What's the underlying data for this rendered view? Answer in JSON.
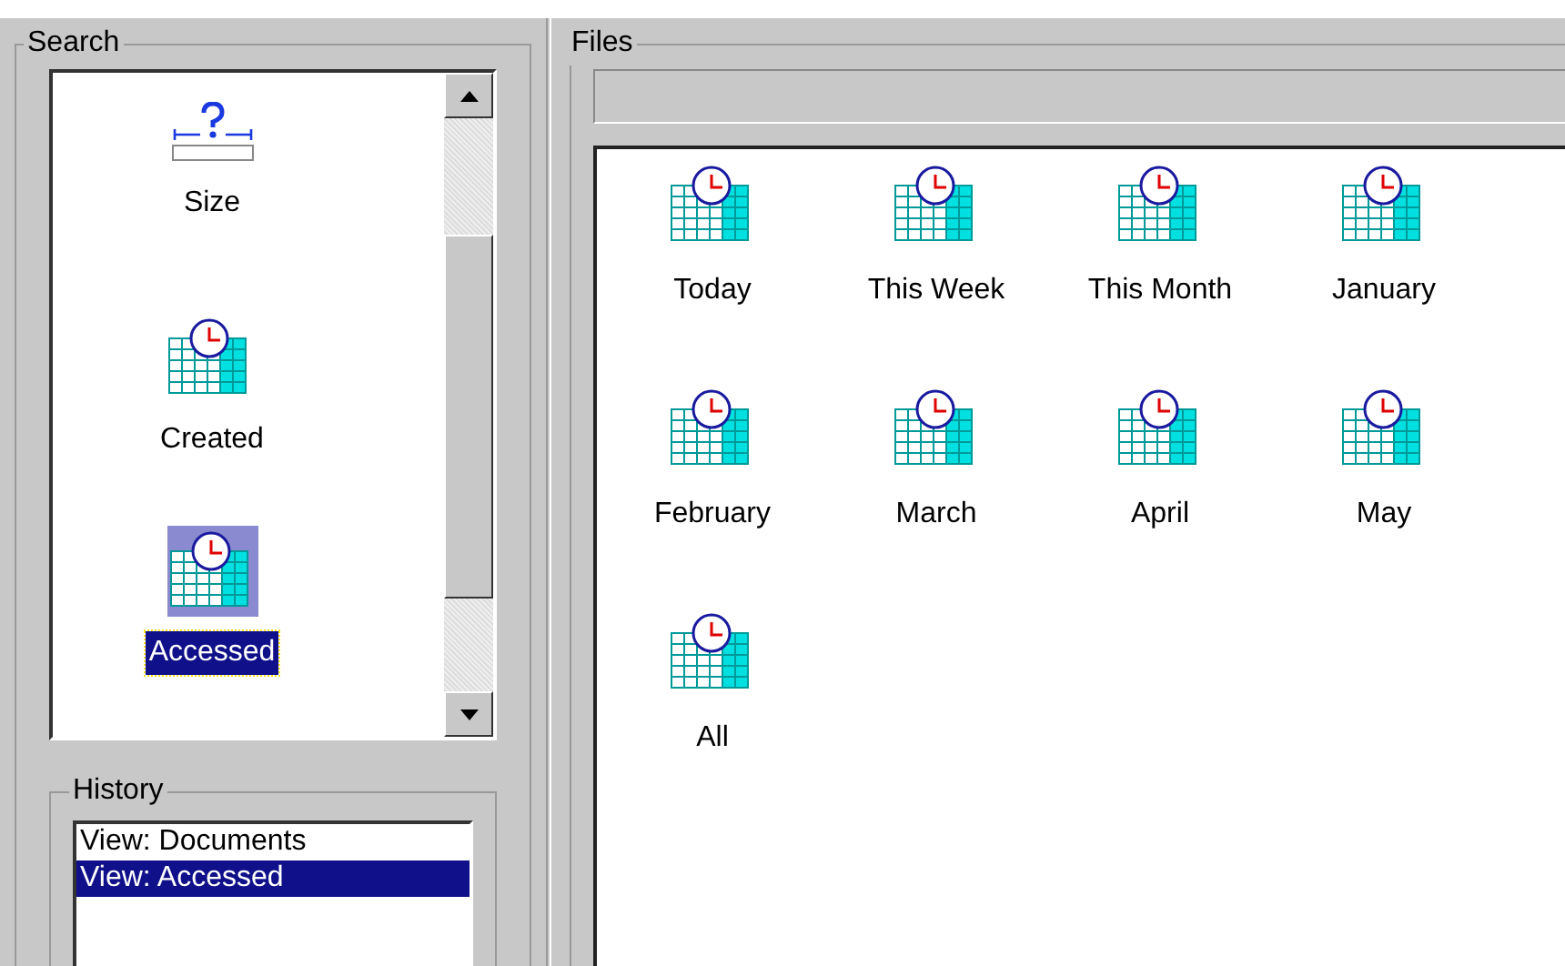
{
  "search": {
    "title": "Search",
    "items": [
      {
        "label": "Size",
        "kind": "size",
        "selected": false
      },
      {
        "label": "Created",
        "kind": "calendar",
        "selected": false
      },
      {
        "label": "Accessed",
        "kind": "calendar",
        "selected": true
      }
    ]
  },
  "history": {
    "title": "History",
    "items": [
      {
        "label": "View: Documents",
        "selected": false
      },
      {
        "label": "View: Accessed",
        "selected": true
      }
    ]
  },
  "files": {
    "title": "Files",
    "items": [
      {
        "label": "Today"
      },
      {
        "label": "This Week"
      },
      {
        "label": "This Month"
      },
      {
        "label": "January"
      },
      {
        "label": "February"
      },
      {
        "label": "March"
      },
      {
        "label": "April"
      },
      {
        "label": "May"
      },
      {
        "label": "All"
      }
    ]
  }
}
